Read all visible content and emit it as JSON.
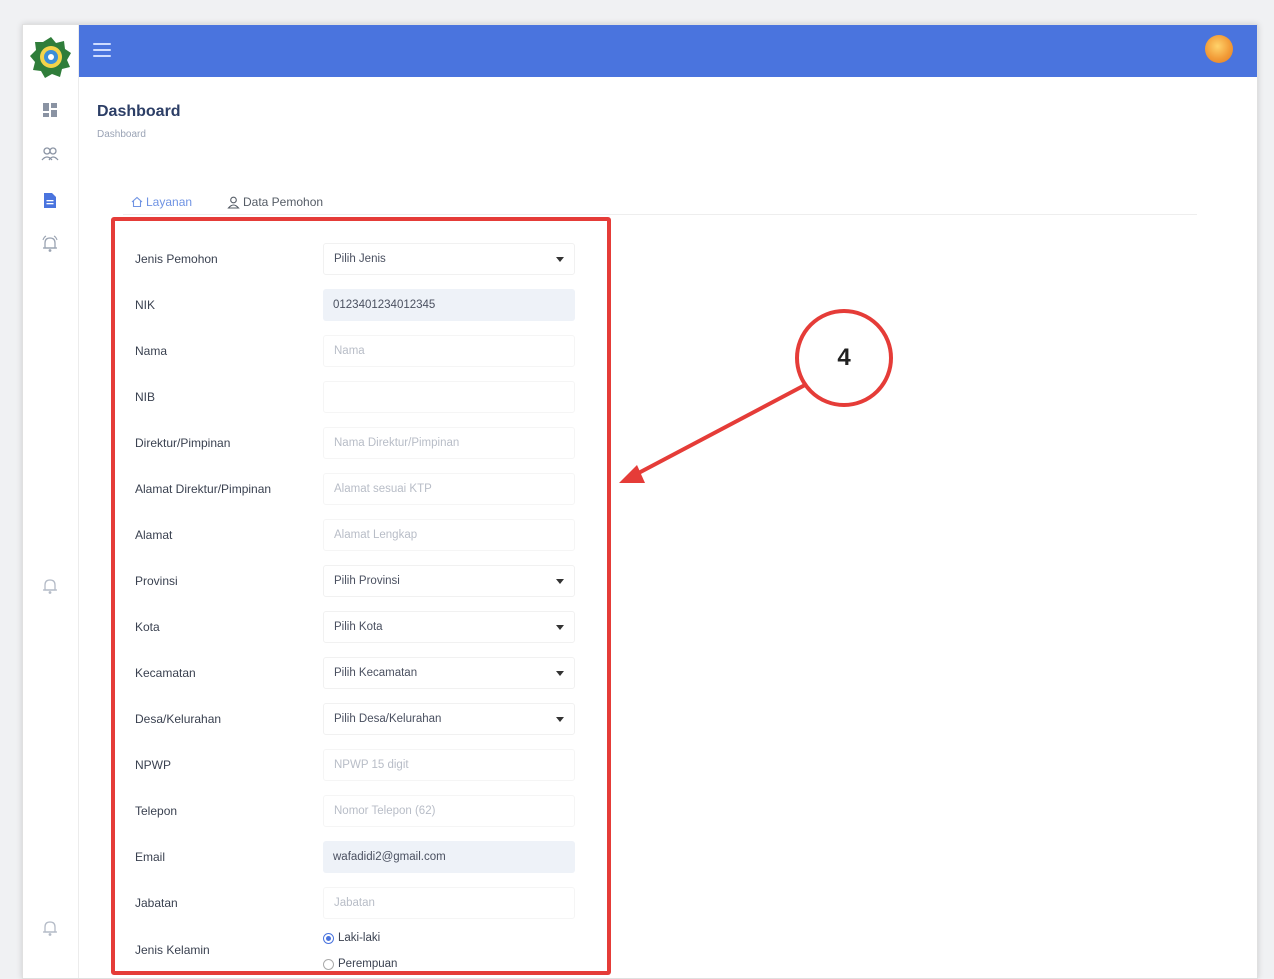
{
  "header": {
    "page_title": "Dashboard",
    "breadcrumb": "Dashboard"
  },
  "tabs": [
    {
      "label": "Layanan",
      "icon": "home-icon",
      "active": true
    },
    {
      "label": "Data Pemohon",
      "icon": "user-icon",
      "active": false
    }
  ],
  "form": {
    "fields": [
      {
        "label": "Jenis Pemohon",
        "type": "select",
        "value": "Pilih Jenis"
      },
      {
        "label": "NIK",
        "type": "input",
        "value": "0123401234012345"
      },
      {
        "label": "Nama",
        "type": "input",
        "placeholder": "Nama"
      },
      {
        "label": "NIB",
        "type": "input",
        "placeholder": ""
      },
      {
        "label": "Direktur/Pimpinan",
        "type": "input",
        "placeholder": "Nama Direktur/Pimpinan"
      },
      {
        "label": "Alamat Direktur/Pimpinan",
        "type": "input",
        "placeholder": "Alamat sesuai KTP"
      },
      {
        "label": "Alamat",
        "type": "input",
        "placeholder": "Alamat Lengkap"
      },
      {
        "label": "Provinsi",
        "type": "select",
        "value": "Pilih Provinsi"
      },
      {
        "label": "Kota",
        "type": "select",
        "value": "Pilih Kota"
      },
      {
        "label": "Kecamatan",
        "type": "select",
        "value": "Pilih Kecamatan"
      },
      {
        "label": "Desa/Kelurahan",
        "type": "select",
        "value": "Pilih Desa/Kelurahan"
      },
      {
        "label": "NPWP",
        "type": "input",
        "placeholder": "NPWP 15 digit"
      },
      {
        "label": "Telepon",
        "type": "input",
        "placeholder": "Nomor Telepon (62)"
      },
      {
        "label": "Email",
        "type": "input",
        "value": "wafadidi2@gmail.com"
      },
      {
        "label": "Jabatan",
        "type": "input",
        "placeholder": "Jabatan"
      }
    ],
    "gender": {
      "label": "Jenis Kelamin",
      "options": [
        "Laki-laki",
        "Perempuan"
      ],
      "selected": "Laki-laki"
    }
  },
  "annotation": {
    "callout_number": "4",
    "color": "#e53c38"
  },
  "colors": {
    "topbar": "#4a74de",
    "accent": "#6f93e3"
  }
}
